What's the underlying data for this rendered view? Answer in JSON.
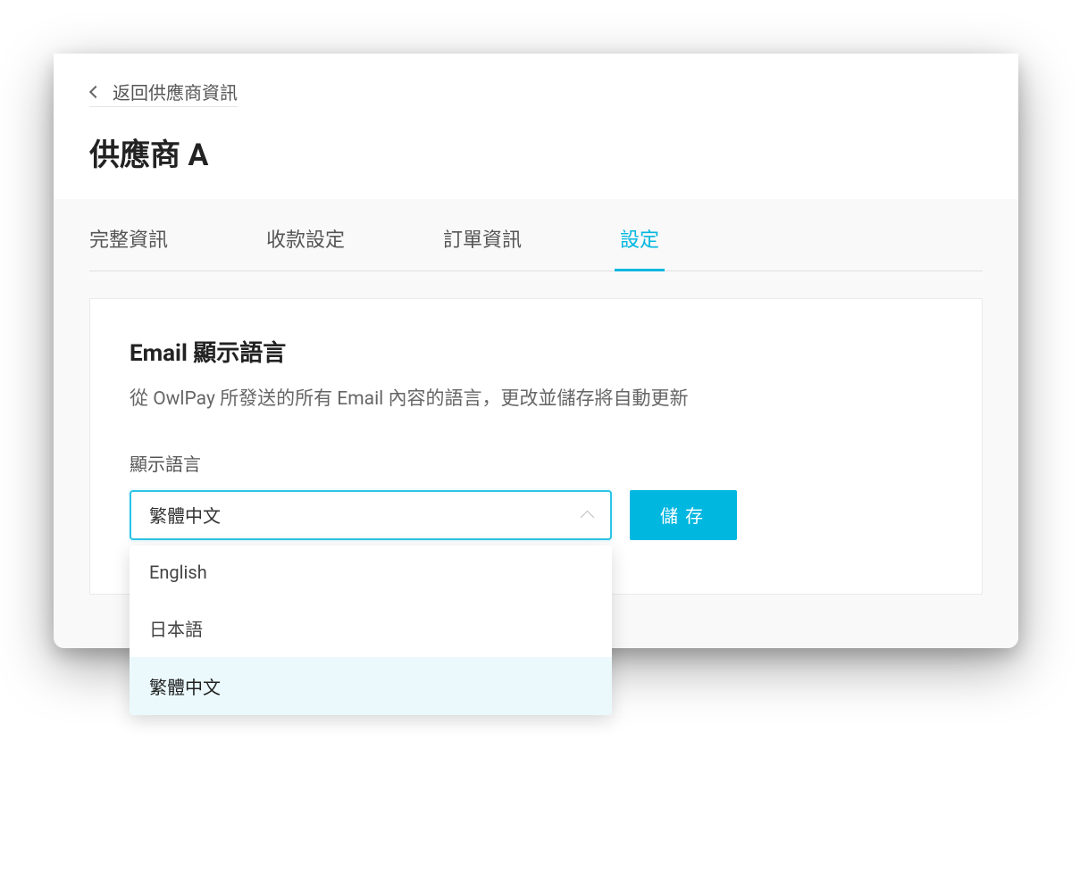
{
  "header": {
    "back_label": "返回供應商資訊",
    "title": "供應商 A"
  },
  "tabs": [
    {
      "label": "完整資訊",
      "active": false
    },
    {
      "label": "收款設定",
      "active": false
    },
    {
      "label": "訂單資訊",
      "active": false
    },
    {
      "label": "設定",
      "active": true
    }
  ],
  "settings": {
    "section_title": "Email 顯示語言",
    "section_desc": "從 OwlPay 所發送的所有 Email 內容的語言，更改並儲存將自動更新",
    "field_label": "顯示語言",
    "selected_value": "繁體中文",
    "save_button": "儲存",
    "options": [
      {
        "label": "English",
        "selected": false
      },
      {
        "label": "日本語",
        "selected": false
      },
      {
        "label": "繁體中文",
        "selected": true
      }
    ]
  },
  "colors": {
    "accent": "#00b7e0"
  }
}
